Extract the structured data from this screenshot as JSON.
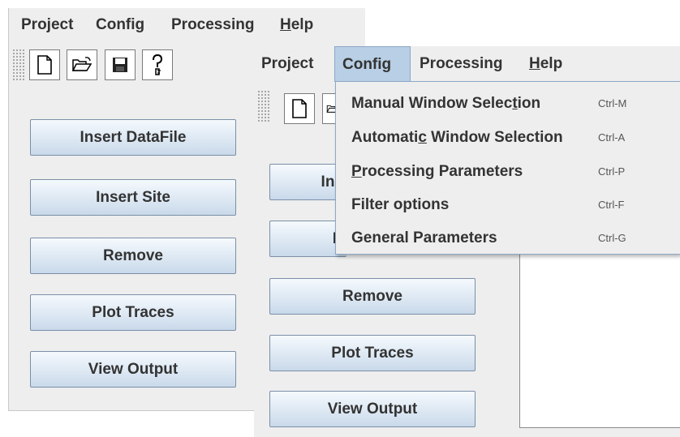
{
  "back_window": {
    "menubar": [
      {
        "label": "Project"
      },
      {
        "label": "Config"
      },
      {
        "label": "Processing"
      },
      {
        "mnemonic": "H",
        "rest": "elp"
      }
    ],
    "toolbar": [
      "new-file-icon",
      "open-folder-icon",
      "save-icon",
      "help-key-icon"
    ],
    "buttons": [
      "Insert DataFile",
      "Insert Site",
      "Remove",
      "Plot Traces",
      "View Output"
    ]
  },
  "front_window": {
    "menubar": [
      {
        "label": "Project"
      },
      {
        "label": "Config",
        "open": true
      },
      {
        "label": "Processing"
      },
      {
        "mnemonic": "H",
        "rest": "elp"
      }
    ],
    "toolbar": [
      "new-file-icon",
      "open-folder-icon"
    ],
    "buttons": [
      "Ins",
      "I",
      "Remove",
      "Plot Traces",
      "View Output"
    ]
  },
  "config_menu": {
    "items": [
      {
        "pre": "Manual Window Selec",
        "mn": "t",
        "post": "ion",
        "accel": "Ctrl-M"
      },
      {
        "pre": "Automati",
        "mn": "c",
        "post": " Window Selection",
        "accel": "Ctrl-A"
      },
      {
        "pre": "",
        "mn": "P",
        "post": "rocessing Parameters",
        "accel": "Ctrl-P"
      },
      {
        "pre": "Filter options",
        "mn": "",
        "post": "",
        "accel": "Ctrl-F"
      },
      {
        "pre": "General Parameters",
        "mn": "",
        "post": "",
        "accel": "Ctrl-G"
      }
    ]
  },
  "colors": {
    "window_bg": "#eeeeee",
    "menu_highlight": "#b8cfe5",
    "button_border": "#7b8fa7"
  }
}
